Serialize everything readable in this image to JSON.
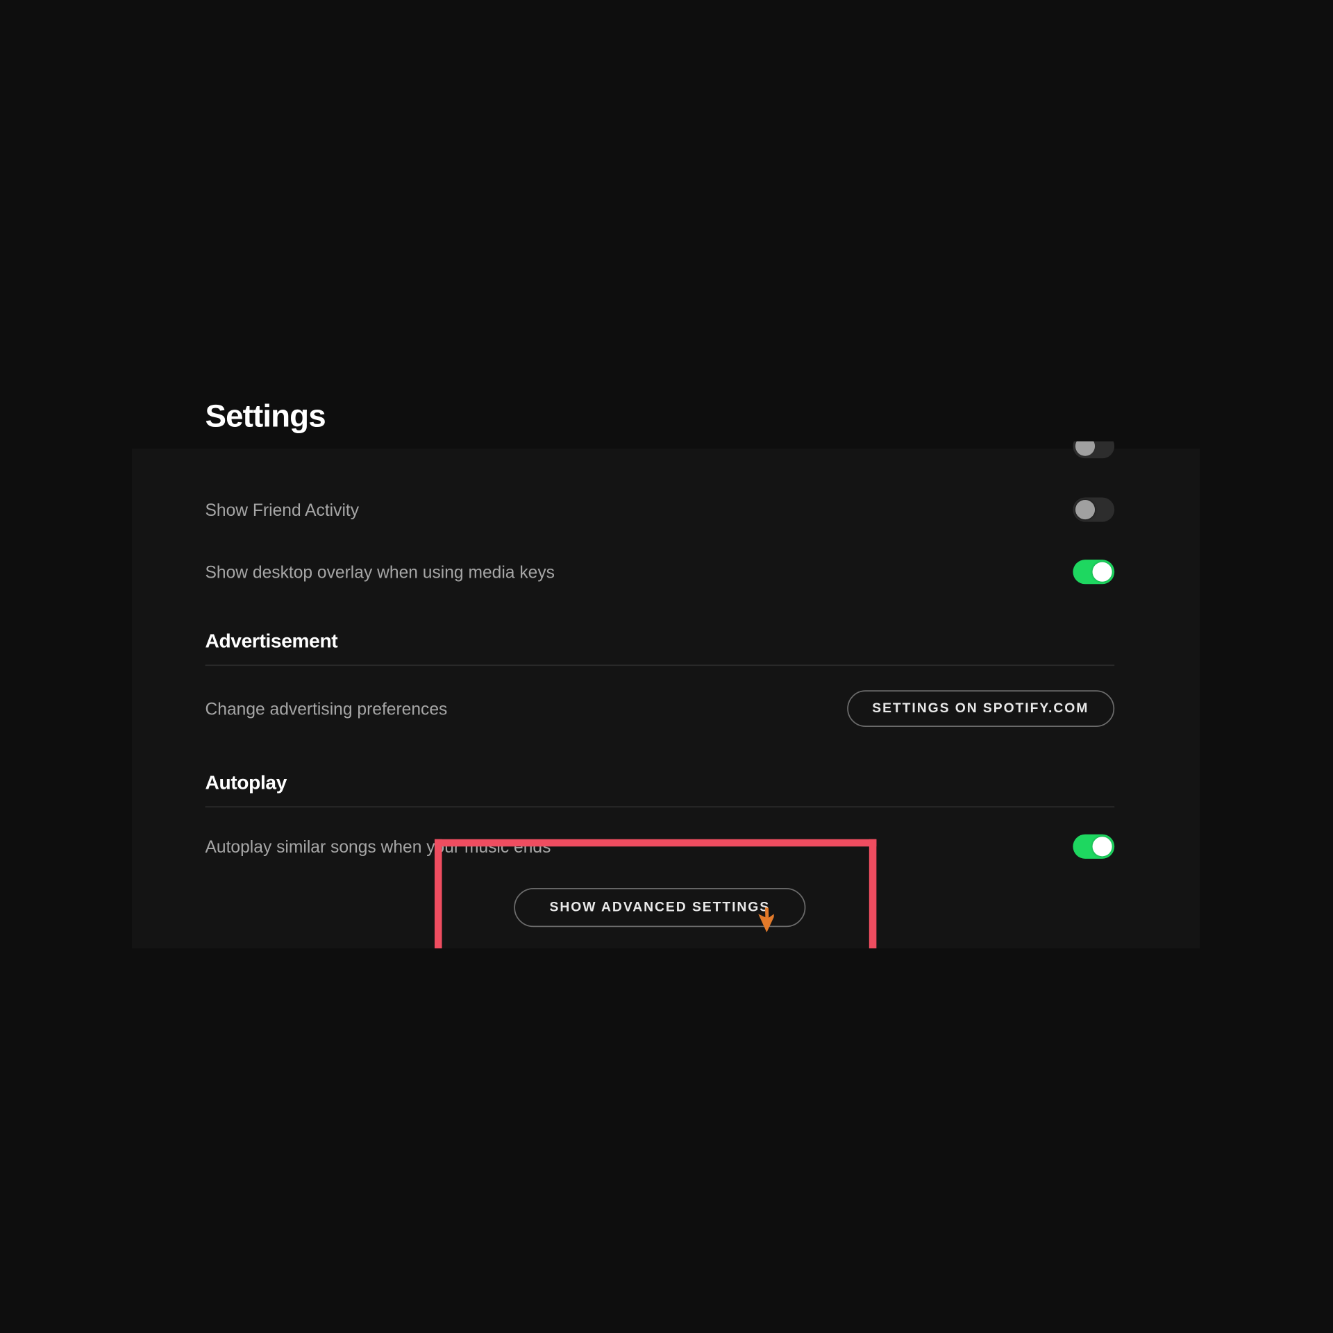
{
  "pageTitle": "Settings",
  "displayRows": {
    "friendActivity": {
      "label": "Show Friend Activity",
      "on": false
    },
    "desktopOverlay": {
      "label": "Show desktop overlay when using media keys",
      "on": true
    }
  },
  "advertisement": {
    "heading": "Advertisement",
    "preferencesLabel": "Change advertising preferences",
    "buttonLabel": "SETTINGS ON SPOTIFY.COM"
  },
  "autoplay": {
    "heading": "Autoplay",
    "rowLabel": "Autoplay similar songs when your music ends",
    "on": true
  },
  "advancedButton": "SHOW ADVANCED SETTINGS",
  "colors": {
    "accent": "#1ed760",
    "highlight": "#ef4d60",
    "cursor": "#e37a2a"
  }
}
